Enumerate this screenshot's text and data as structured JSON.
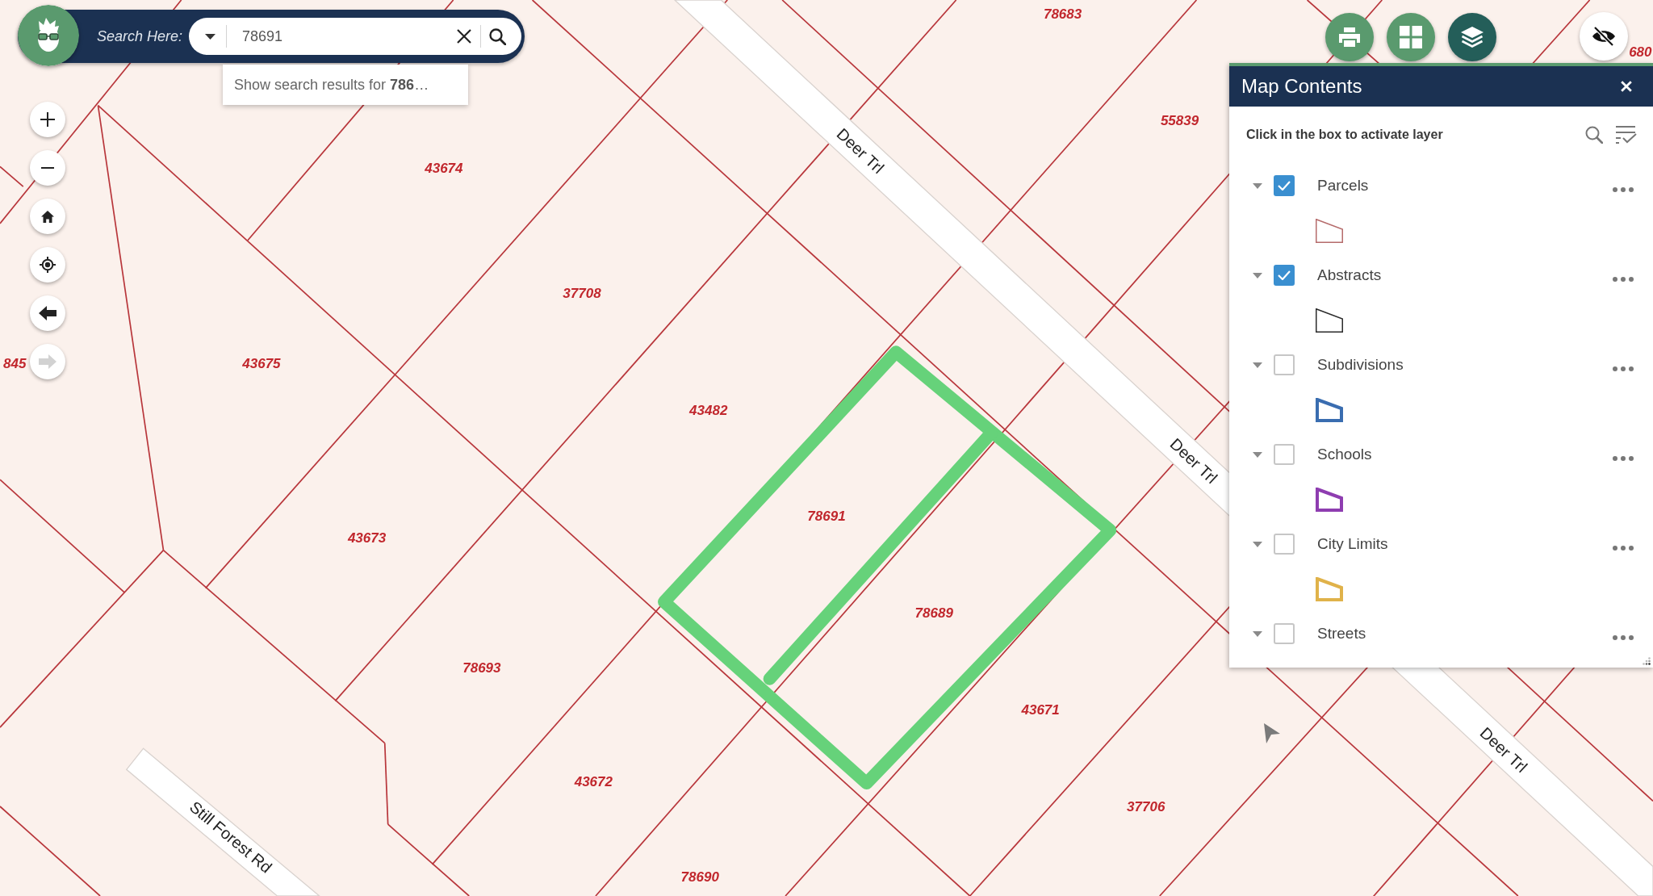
{
  "search_bar": {
    "label": "Search Here:",
    "value": "78691",
    "suggestion": "Show search results for **786**…"
  },
  "toolbar": [
    {
      "kind": "print",
      "selected": false
    },
    {
      "kind": "basemap",
      "selected": false
    },
    {
      "kind": "layers",
      "selected": true
    }
  ],
  "map_controls": [
    {
      "kind": "zoom_in",
      "disabled": false
    },
    {
      "kind": "zoom_out",
      "disabled": false
    },
    {
      "kind": "home",
      "disabled": false
    },
    {
      "kind": "locate",
      "disabled": false
    },
    {
      "kind": "back",
      "disabled": false
    },
    {
      "kind": "forward",
      "disabled": true
    }
  ],
  "map": {
    "parcel_labels": [
      "78683",
      "680",
      "55839",
      "43674",
      "37708",
      "845",
      "43675",
      "43482",
      "78691",
      "43673",
      "78689",
      "78693",
      "43671",
      "43672",
      "37706",
      "78690"
    ],
    "street_labels": [
      "Deer Trl",
      "Deer Trl",
      "Deer Trl",
      "Still Forest Rd"
    ]
  },
  "map_contents": {
    "title": "Map Contents",
    "hint": "Click in the box to activate layer",
    "layers": [
      {
        "name": "Parcels",
        "checked": true,
        "expanded": true,
        "symbol": {
          "kind": "thin",
          "color": "#b56b6b"
        }
      },
      {
        "name": "Abstracts",
        "checked": true,
        "expanded": true,
        "symbol": {
          "kind": "thin",
          "color": "#2b2b2b"
        }
      },
      {
        "name": "Subdivisions",
        "checked": false,
        "expanded": true,
        "symbol": {
          "kind": "thick",
          "color": "#3a6db0"
        }
      },
      {
        "name": "Schools",
        "checked": false,
        "expanded": true,
        "symbol": {
          "kind": "thick",
          "color": "#8e3db0"
        }
      },
      {
        "name": "City Limits",
        "checked": false,
        "expanded": true,
        "symbol": {
          "kind": "thick",
          "color": "#e0b24a"
        }
      },
      {
        "name": "Streets",
        "checked": false,
        "expanded": true
      }
    ]
  }
}
